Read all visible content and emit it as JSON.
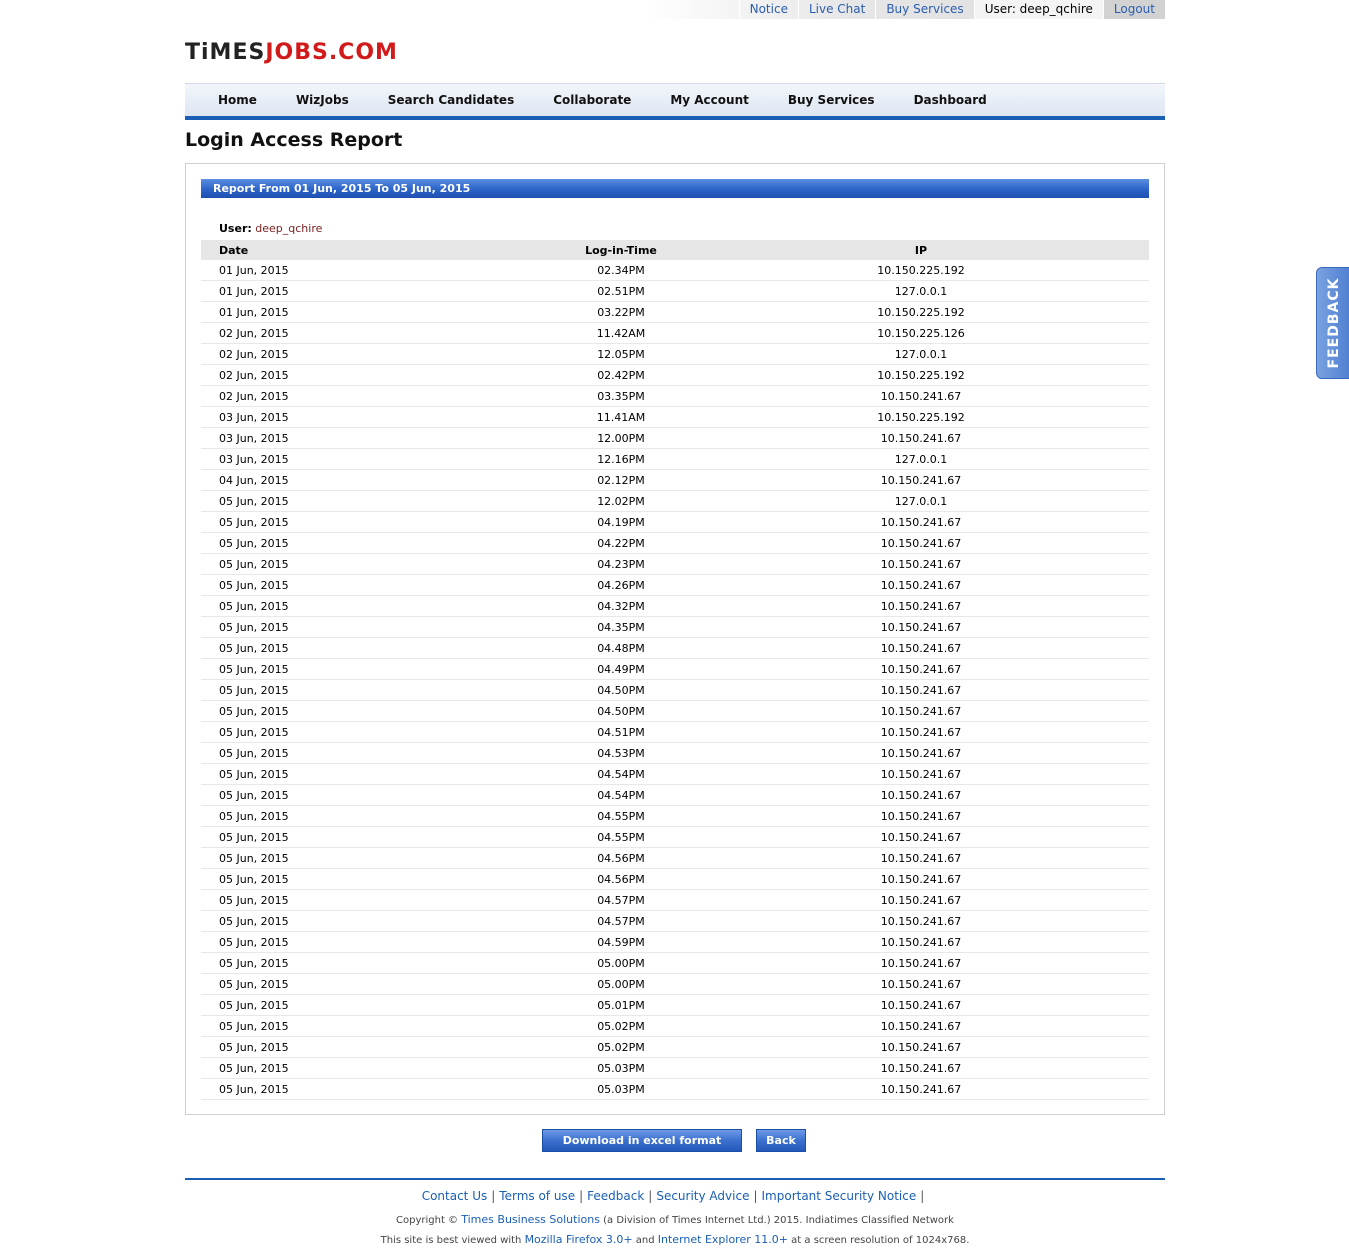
{
  "topbar": {
    "notice": "Notice",
    "live_chat": "Live Chat",
    "buy_services": "Buy Services",
    "user_label": "User: deep_qchire",
    "logout": "Logout"
  },
  "logo": {
    "part1": "TiMES",
    "part2": "JOBS.COM"
  },
  "nav": [
    "Home",
    "WizJobs",
    "Search Candidates",
    "Collaborate",
    "My Account",
    "Buy Services",
    "Dashboard"
  ],
  "page_title": "Login Access Report",
  "report": {
    "header": "Report From 01 Jun, 2015 To 05 Jun, 2015",
    "user_label": "User:",
    "user_value": "deep_qchire",
    "columns": [
      "Date",
      "Log-in-Time",
      "IP"
    ],
    "rows": [
      [
        "01 Jun, 2015",
        "02.34PM",
        "10.150.225.192"
      ],
      [
        "01 Jun, 2015",
        "02.51PM",
        "127.0.0.1"
      ],
      [
        "01 Jun, 2015",
        "03.22PM",
        "10.150.225.192"
      ],
      [
        "02 Jun, 2015",
        "11.42AM",
        "10.150.225.126"
      ],
      [
        "02 Jun, 2015",
        "12.05PM",
        "127.0.0.1"
      ],
      [
        "02 Jun, 2015",
        "02.42PM",
        "10.150.225.192"
      ],
      [
        "02 Jun, 2015",
        "03.35PM",
        "10.150.241.67"
      ],
      [
        "03 Jun, 2015",
        "11.41AM",
        "10.150.225.192"
      ],
      [
        "03 Jun, 2015",
        "12.00PM",
        "10.150.241.67"
      ],
      [
        "03 Jun, 2015",
        "12.16PM",
        "127.0.0.1"
      ],
      [
        "04 Jun, 2015",
        "02.12PM",
        "10.150.241.67"
      ],
      [
        "05 Jun, 2015",
        "12.02PM",
        "127.0.0.1"
      ],
      [
        "05 Jun, 2015",
        "04.19PM",
        "10.150.241.67"
      ],
      [
        "05 Jun, 2015",
        "04.22PM",
        "10.150.241.67"
      ],
      [
        "05 Jun, 2015",
        "04.23PM",
        "10.150.241.67"
      ],
      [
        "05 Jun, 2015",
        "04.26PM",
        "10.150.241.67"
      ],
      [
        "05 Jun, 2015",
        "04.32PM",
        "10.150.241.67"
      ],
      [
        "05 Jun, 2015",
        "04.35PM",
        "10.150.241.67"
      ],
      [
        "05 Jun, 2015",
        "04.48PM",
        "10.150.241.67"
      ],
      [
        "05 Jun, 2015",
        "04.49PM",
        "10.150.241.67"
      ],
      [
        "05 Jun, 2015",
        "04.50PM",
        "10.150.241.67"
      ],
      [
        "05 Jun, 2015",
        "04.50PM",
        "10.150.241.67"
      ],
      [
        "05 Jun, 2015",
        "04.51PM",
        "10.150.241.67"
      ],
      [
        "05 Jun, 2015",
        "04.53PM",
        "10.150.241.67"
      ],
      [
        "05 Jun, 2015",
        "04.54PM",
        "10.150.241.67"
      ],
      [
        "05 Jun, 2015",
        "04.54PM",
        "10.150.241.67"
      ],
      [
        "05 Jun, 2015",
        "04.55PM",
        "10.150.241.67"
      ],
      [
        "05 Jun, 2015",
        "04.55PM",
        "10.150.241.67"
      ],
      [
        "05 Jun, 2015",
        "04.56PM",
        "10.150.241.67"
      ],
      [
        "05 Jun, 2015",
        "04.56PM",
        "10.150.241.67"
      ],
      [
        "05 Jun, 2015",
        "04.57PM",
        "10.150.241.67"
      ],
      [
        "05 Jun, 2015",
        "04.57PM",
        "10.150.241.67"
      ],
      [
        "05 Jun, 2015",
        "04.59PM",
        "10.150.241.67"
      ],
      [
        "05 Jun, 2015",
        "05.00PM",
        "10.150.241.67"
      ],
      [
        "05 Jun, 2015",
        "05.00PM",
        "10.150.241.67"
      ],
      [
        "05 Jun, 2015",
        "05.01PM",
        "10.150.241.67"
      ],
      [
        "05 Jun, 2015",
        "05.02PM",
        "10.150.241.67"
      ],
      [
        "05 Jun, 2015",
        "05.02PM",
        "10.150.241.67"
      ],
      [
        "05 Jun, 2015",
        "05.03PM",
        "10.150.241.67"
      ],
      [
        "05 Jun, 2015",
        "05.03PM",
        "10.150.241.67"
      ]
    ]
  },
  "buttons": {
    "download": "Download in excel format",
    "back": "Back"
  },
  "footer": {
    "links": [
      "Contact Us",
      "Terms of use",
      "Feedback",
      "Security Advice",
      "Important Security Notice"
    ],
    "copy_prefix": "Copyright ©",
    "copy_company": "Times Business Solutions",
    "copy_suffix": "(a Division of Times Internet Ltd.) 2015. Indiatimes Classified Network",
    "best_prefix": "This site is best viewed with",
    "best_firefox": "Mozilla Firefox 3.0+",
    "best_and": "and",
    "best_ie": "Internet Explorer 11.0+",
    "best_suffix": "at a screen resolution of 1024x768."
  },
  "feedback_tab": "FEEDBACK"
}
